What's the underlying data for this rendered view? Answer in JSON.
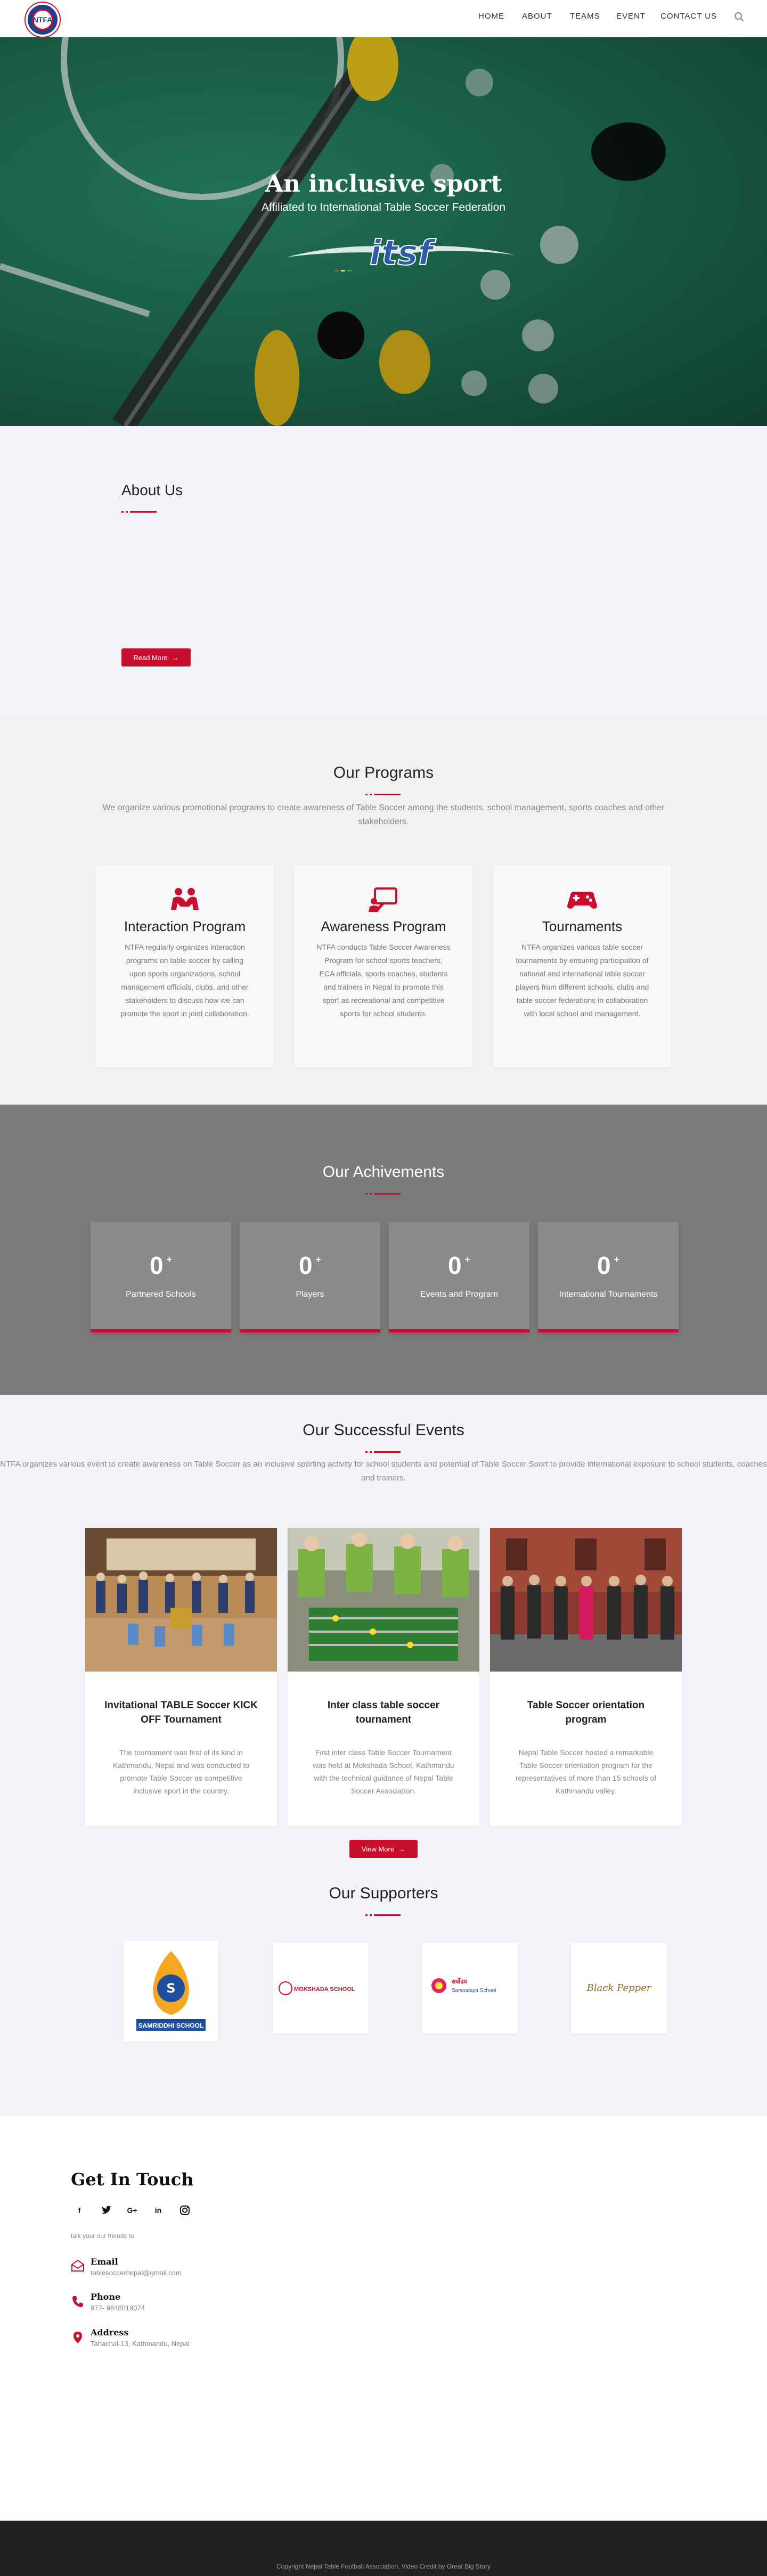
{
  "nav": {
    "logo_text": "NTFA",
    "items": [
      "HOME",
      "ABOUT",
      "TEAMS",
      "EVENT",
      "CONTACT US"
    ]
  },
  "hero": {
    "title": "An inclusive sport",
    "subtitle": "Affiliated to International Table Soccer Federation",
    "logo_text": "itsf"
  },
  "about": {
    "title": "About Us",
    "button": "Read More"
  },
  "programs": {
    "title": "Our Programs",
    "description": "We organize various promotional programs to create awareness of Table Soccer among the students, school management, sports coaches and other stakeholders.",
    "cards": [
      {
        "icon": "people-icon",
        "title": "Interaction Program",
        "text": "NTFA regularly organizes interaction programs on table soccer by calling upon sports organizations, school management officials, clubs, and other stakeholders to discuss how we can promote the sport in joint collaboration."
      },
      {
        "icon": "presentation-icon",
        "title": "Awareness Program",
        "text": "NTFA conducts Table Soccer Awareness Program for school sports teachers, ECA officials, sports coaches, students and trainers in Nepal to promote this sport as recreational and competitive sports for school students."
      },
      {
        "icon": "gamepad-icon",
        "title": "Tournaments",
        "text": "NTFA organizes various table soccer tournaments by ensuring participation of national and international table soccer players from different schools, clubs and table soccer federations in collaboration with local school and management."
      }
    ]
  },
  "achievements": {
    "title": "Our Achivements",
    "items": [
      {
        "value": "0",
        "suffix": "+",
        "label": "Partnered Schools"
      },
      {
        "value": "0",
        "suffix": "+",
        "label": "Players"
      },
      {
        "value": "0",
        "suffix": "+",
        "label": "Events and Program"
      },
      {
        "value": "0",
        "suffix": "+",
        "label": "International Tournaments"
      }
    ]
  },
  "events": {
    "title": "Our Successful Events",
    "description": "NTFA organizes various event to create awareness on Table Soccer as an inclusive sporting activity for school students and potential of  Table Soccer Sport to provide international exposure to school  students, coaches and trainers.",
    "cards": [
      {
        "title": "Invitational TABLE Soccer KICK OFF Tournament",
        "text": "The tournament was first of its kind in Kathmandu, Nepal and was conducted to promote Table Soccer as competitive inclusive sport in the country."
      },
      {
        "title": "Inter class table soccer tournament",
        "text": "First inter class Table Soccer Tournament was held at Mokshada School, Kathmandu with the technical guidance of Nepal Table Soccer Association."
      },
      {
        "title": "Table Soccer orientation program",
        "text": "Nepal Table Soccer hosted a remarkable Table Soccer orientation program for the representatives of more than 15 schools of Kathmandu valley."
      }
    ],
    "button": "View More"
  },
  "supporters": {
    "title": "Our Supporters",
    "logos": [
      {
        "name": "SAMRIDDHI SCHOOL"
      },
      {
        "name": "MOKSHADA SCHOOL"
      },
      {
        "name": "Sarwodaya School"
      },
      {
        "name": "Black Pepper"
      }
    ]
  },
  "contact": {
    "title": "Get In Touch",
    "social": [
      "f",
      "twitter",
      "G+",
      "in",
      "instagram"
    ],
    "tagline": "talk your our friends to",
    "email_label": "Email",
    "email_value": "tablesoccernepal@gmail.com",
    "phone_label": "Phone",
    "phone_value": "977- 9848019074",
    "address_label": "Address",
    "address_value": "Tahachal-13, Kathmandu, Nepal"
  },
  "footer": {
    "text": "Copyright Nepal Table Football Association, Video Credit by Great Big Story"
  },
  "colors": {
    "accent": "#c8102e",
    "hero_green": "#1e6e52",
    "achievements_bg": "#7b7b7b",
    "footer_bg": "#222222"
  }
}
